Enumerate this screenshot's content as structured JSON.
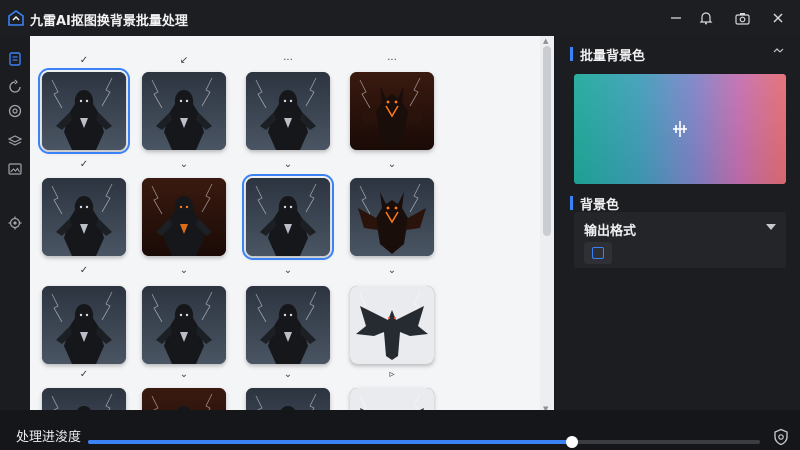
{
  "window": {
    "title": "九雷AI抠图换背景批量处理",
    "icons": [
      "app-logo",
      "minimize-icon",
      "bell-icon",
      "camera-icon",
      "close-icon"
    ]
  },
  "sidebar": {
    "icons": [
      "clipboard-icon",
      "history-icon",
      "settings-icon",
      "layers-icon",
      "image-icon",
      "gear-icon"
    ],
    "active": "clipboard-icon"
  },
  "gallery": {
    "top_marks": [
      "✓",
      "↙",
      "···",
      "···"
    ],
    "row_marks": [
      [
        "✓",
        "⌄",
        "⌄",
        "⌄"
      ],
      [
        "✓",
        "⌄",
        "⌄",
        "⌄"
      ],
      [
        "✓",
        "⌄",
        "⌄",
        "▹"
      ]
    ],
    "images": [
      {
        "kind": "knight",
        "selected": true
      },
      {
        "kind": "knight",
        "selected": false
      },
      {
        "kind": "knight",
        "selected": false
      },
      {
        "kind": "demon",
        "selected": false
      },
      {
        "kind": "knight",
        "selected": false
      },
      {
        "kind": "knight-fire",
        "selected": false
      },
      {
        "kind": "knight",
        "selected": true
      },
      {
        "kind": "demon-lord",
        "selected": false
      },
      {
        "kind": "knight",
        "selected": false
      },
      {
        "kind": "knight",
        "selected": false
      },
      {
        "kind": "knight",
        "selected": false
      },
      {
        "kind": "bat-demon",
        "selected": false
      },
      {
        "kind": "knight",
        "selected": false
      },
      {
        "kind": "knight-fire",
        "selected": false
      },
      {
        "kind": "knight",
        "selected": false
      },
      {
        "kind": "bat-demon",
        "selected": false
      }
    ]
  },
  "right_panel": {
    "batch_title": "批量背景色",
    "collapse_icon": "collapse-icon",
    "gradient_colors": [
      "#1faa9a",
      "#3d9fb8",
      "#7a85c9",
      "#c46fb0",
      "#e46d72"
    ],
    "picker_icon": "eyedropper-icon",
    "bg_title": "背景色",
    "format_label": "输出格式",
    "format_checked": false
  },
  "bottom": {
    "progress_label": "处理进浚度",
    "progress": 0.72,
    "accent": "#3b82f6",
    "settings_icon": "shield-gear-icon"
  }
}
